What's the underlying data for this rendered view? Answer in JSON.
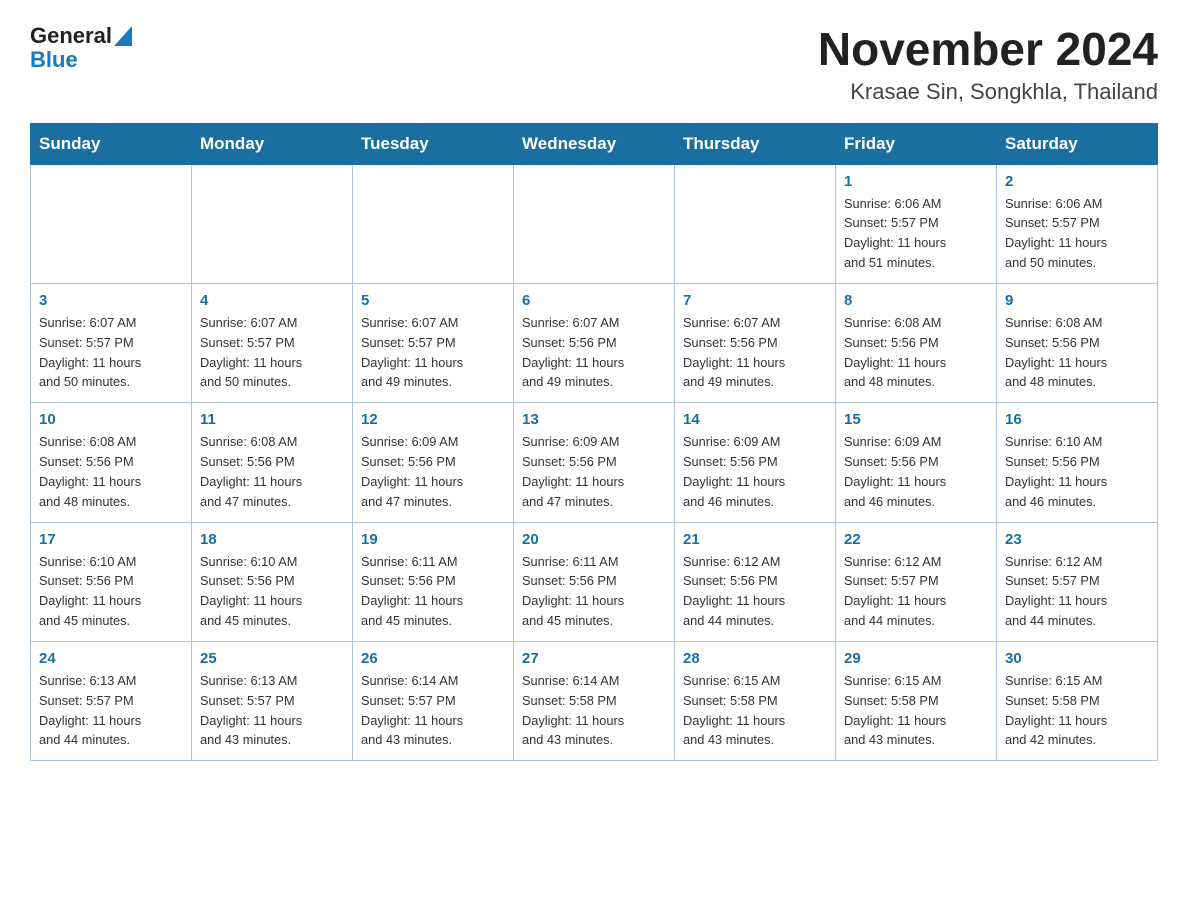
{
  "header": {
    "logo_general": "General",
    "logo_blue": "Blue",
    "main_title": "November 2024",
    "subtitle": "Krasae Sin, Songkhla, Thailand"
  },
  "calendar": {
    "days_of_week": [
      "Sunday",
      "Monday",
      "Tuesday",
      "Wednesday",
      "Thursday",
      "Friday",
      "Saturday"
    ],
    "weeks": [
      [
        {
          "day": "",
          "info": ""
        },
        {
          "day": "",
          "info": ""
        },
        {
          "day": "",
          "info": ""
        },
        {
          "day": "",
          "info": ""
        },
        {
          "day": "",
          "info": ""
        },
        {
          "day": "1",
          "info": "Sunrise: 6:06 AM\nSunset: 5:57 PM\nDaylight: 11 hours\nand 51 minutes."
        },
        {
          "day": "2",
          "info": "Sunrise: 6:06 AM\nSunset: 5:57 PM\nDaylight: 11 hours\nand 50 minutes."
        }
      ],
      [
        {
          "day": "3",
          "info": "Sunrise: 6:07 AM\nSunset: 5:57 PM\nDaylight: 11 hours\nand 50 minutes."
        },
        {
          "day": "4",
          "info": "Sunrise: 6:07 AM\nSunset: 5:57 PM\nDaylight: 11 hours\nand 50 minutes."
        },
        {
          "day": "5",
          "info": "Sunrise: 6:07 AM\nSunset: 5:57 PM\nDaylight: 11 hours\nand 49 minutes."
        },
        {
          "day": "6",
          "info": "Sunrise: 6:07 AM\nSunset: 5:56 PM\nDaylight: 11 hours\nand 49 minutes."
        },
        {
          "day": "7",
          "info": "Sunrise: 6:07 AM\nSunset: 5:56 PM\nDaylight: 11 hours\nand 49 minutes."
        },
        {
          "day": "8",
          "info": "Sunrise: 6:08 AM\nSunset: 5:56 PM\nDaylight: 11 hours\nand 48 minutes."
        },
        {
          "day": "9",
          "info": "Sunrise: 6:08 AM\nSunset: 5:56 PM\nDaylight: 11 hours\nand 48 minutes."
        }
      ],
      [
        {
          "day": "10",
          "info": "Sunrise: 6:08 AM\nSunset: 5:56 PM\nDaylight: 11 hours\nand 48 minutes."
        },
        {
          "day": "11",
          "info": "Sunrise: 6:08 AM\nSunset: 5:56 PM\nDaylight: 11 hours\nand 47 minutes."
        },
        {
          "day": "12",
          "info": "Sunrise: 6:09 AM\nSunset: 5:56 PM\nDaylight: 11 hours\nand 47 minutes."
        },
        {
          "day": "13",
          "info": "Sunrise: 6:09 AM\nSunset: 5:56 PM\nDaylight: 11 hours\nand 47 minutes."
        },
        {
          "day": "14",
          "info": "Sunrise: 6:09 AM\nSunset: 5:56 PM\nDaylight: 11 hours\nand 46 minutes."
        },
        {
          "day": "15",
          "info": "Sunrise: 6:09 AM\nSunset: 5:56 PM\nDaylight: 11 hours\nand 46 minutes."
        },
        {
          "day": "16",
          "info": "Sunrise: 6:10 AM\nSunset: 5:56 PM\nDaylight: 11 hours\nand 46 minutes."
        }
      ],
      [
        {
          "day": "17",
          "info": "Sunrise: 6:10 AM\nSunset: 5:56 PM\nDaylight: 11 hours\nand 45 minutes."
        },
        {
          "day": "18",
          "info": "Sunrise: 6:10 AM\nSunset: 5:56 PM\nDaylight: 11 hours\nand 45 minutes."
        },
        {
          "day": "19",
          "info": "Sunrise: 6:11 AM\nSunset: 5:56 PM\nDaylight: 11 hours\nand 45 minutes."
        },
        {
          "day": "20",
          "info": "Sunrise: 6:11 AM\nSunset: 5:56 PM\nDaylight: 11 hours\nand 45 minutes."
        },
        {
          "day": "21",
          "info": "Sunrise: 6:12 AM\nSunset: 5:56 PM\nDaylight: 11 hours\nand 44 minutes."
        },
        {
          "day": "22",
          "info": "Sunrise: 6:12 AM\nSunset: 5:57 PM\nDaylight: 11 hours\nand 44 minutes."
        },
        {
          "day": "23",
          "info": "Sunrise: 6:12 AM\nSunset: 5:57 PM\nDaylight: 11 hours\nand 44 minutes."
        }
      ],
      [
        {
          "day": "24",
          "info": "Sunrise: 6:13 AM\nSunset: 5:57 PM\nDaylight: 11 hours\nand 44 minutes."
        },
        {
          "day": "25",
          "info": "Sunrise: 6:13 AM\nSunset: 5:57 PM\nDaylight: 11 hours\nand 43 minutes."
        },
        {
          "day": "26",
          "info": "Sunrise: 6:14 AM\nSunset: 5:57 PM\nDaylight: 11 hours\nand 43 minutes."
        },
        {
          "day": "27",
          "info": "Sunrise: 6:14 AM\nSunset: 5:58 PM\nDaylight: 11 hours\nand 43 minutes."
        },
        {
          "day": "28",
          "info": "Sunrise: 6:15 AM\nSunset: 5:58 PM\nDaylight: 11 hours\nand 43 minutes."
        },
        {
          "day": "29",
          "info": "Sunrise: 6:15 AM\nSunset: 5:58 PM\nDaylight: 11 hours\nand 43 minutes."
        },
        {
          "day": "30",
          "info": "Sunrise: 6:15 AM\nSunset: 5:58 PM\nDaylight: 11 hours\nand 42 minutes."
        }
      ]
    ]
  }
}
